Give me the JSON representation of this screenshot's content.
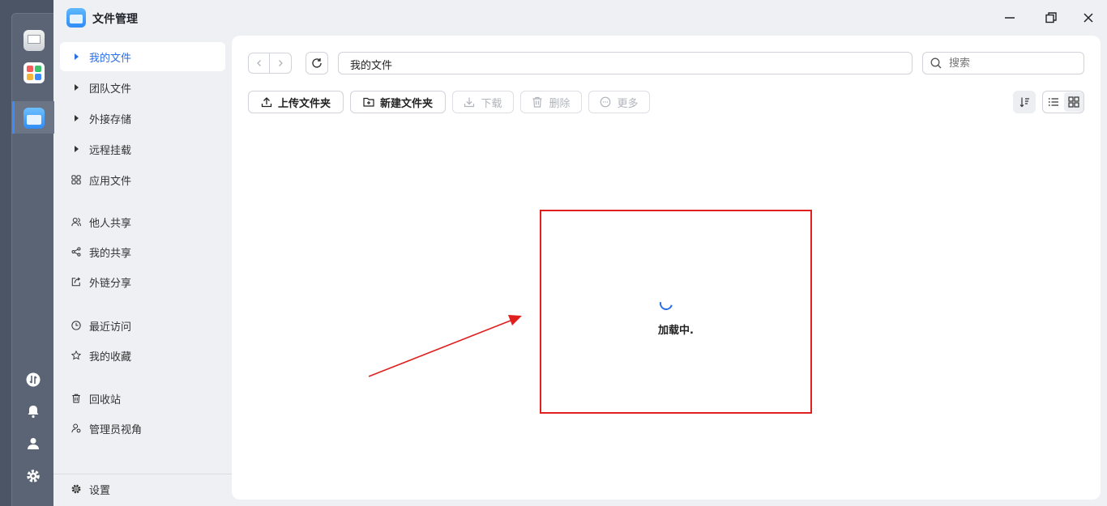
{
  "window": {
    "title": "文件管理"
  },
  "sidebar": {
    "items": [
      {
        "label": "我的文件",
        "icon": "triangle-right-icon",
        "active": true
      },
      {
        "label": "团队文件",
        "icon": "triangle-right-icon"
      },
      {
        "label": "外接存储",
        "icon": "triangle-right-icon"
      },
      {
        "label": "远程挂载",
        "icon": "triangle-right-icon"
      },
      {
        "label": "应用文件",
        "icon": "apps-grid-icon"
      },
      {
        "label": "他人共享",
        "icon": "users-icon"
      },
      {
        "label": "我的共享",
        "icon": "share-icon"
      },
      {
        "label": "外链分享",
        "icon": "external-link-icon"
      },
      {
        "label": "最近访问",
        "icon": "clock-icon"
      },
      {
        "label": "我的收藏",
        "icon": "star-icon"
      },
      {
        "label": "回收站",
        "icon": "trash-icon"
      },
      {
        "label": "管理员视角",
        "icon": "admin-icon"
      }
    ],
    "settings_label": "设置"
  },
  "toolbar": {
    "path": "我的文件",
    "search_placeholder": "搜索",
    "upload_folder": "上传文件夹",
    "new_folder": "新建文件夹",
    "download": "下载",
    "delete": "删除",
    "more": "更多"
  },
  "content": {
    "loading_text": "加载中."
  },
  "colors": {
    "accent": "#2a6ee8",
    "highlight_box": "#e0201e",
    "dock_bg": "#4b5566"
  }
}
